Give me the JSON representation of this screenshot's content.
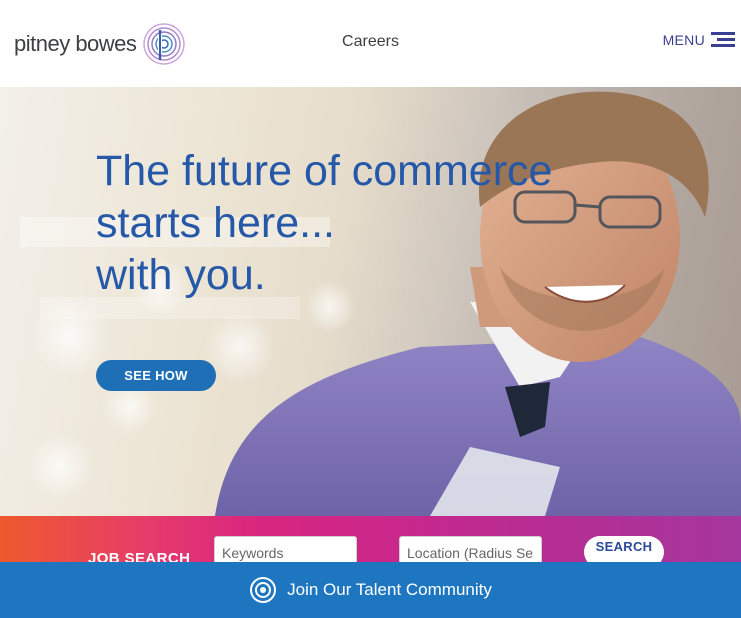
{
  "header": {
    "logo_text": "pitney bowes",
    "logo_icon": "pitney-bowes-logo",
    "title": "Careers",
    "menu_label": "MENU",
    "menu_icon": "hamburger-icon"
  },
  "hero": {
    "headline": [
      "The future of commerce",
      "starts here...",
      "with you."
    ],
    "cta_label": "SEE HOW",
    "image": "smiling-man-in-purple-sweater-photo"
  },
  "job_search": {
    "label": "JOB SEARCH",
    "keywords_placeholder": "Keywords",
    "location_placeholder": "Location (Radius Se",
    "search_label": "SEARCH"
  },
  "talent": {
    "label": "Join Our Talent Community",
    "icon": "target-circle-icon"
  },
  "colors": {
    "brand_blue": "#2558a8",
    "button_blue": "#1f6fb6",
    "menu_navy": "#3b3f91",
    "talent_bar": "#1d76bf",
    "gradient_start": "#ee5a2c",
    "gradient_end": "#a5369d"
  }
}
